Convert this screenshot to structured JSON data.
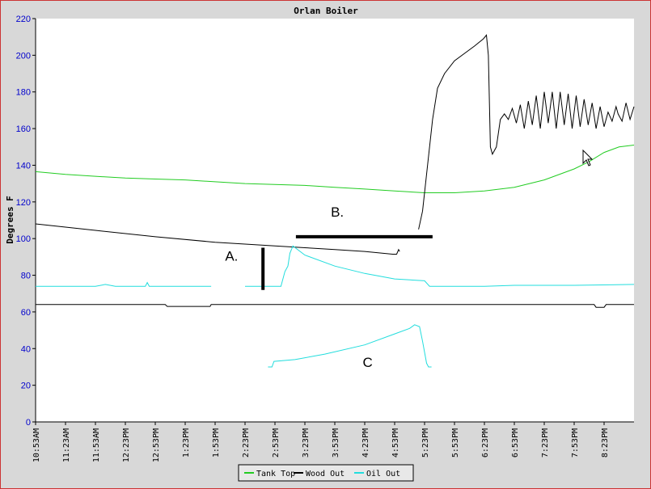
{
  "chart_data": {
    "type": "line",
    "title": "Orlan Boiler",
    "ylabel": "Degrees F",
    "xlabel": "",
    "ylim": [
      0,
      220
    ],
    "y_ticks": [
      0,
      20,
      40,
      60,
      80,
      100,
      120,
      140,
      160,
      180,
      200,
      220
    ],
    "x_ticks": [
      "10:53AM",
      "11:23AM",
      "11:53AM",
      "12:23PM",
      "12:53PM",
      "1:23PM",
      "1:53PM",
      "2:23PM",
      "2:53PM",
      "3:23PM",
      "3:53PM",
      "4:23PM",
      "4:53PM",
      "5:23PM",
      "5:53PM",
      "6:23PM",
      "6:53PM",
      "7:23PM",
      "7:53PM",
      "8:23PM"
    ],
    "x_ticks_minutes": [
      0,
      30,
      60,
      90,
      120,
      150,
      180,
      210,
      240,
      270,
      300,
      330,
      360,
      390,
      420,
      450,
      480,
      510,
      540,
      570
    ],
    "xlim_minutes": [
      0,
      600
    ],
    "grid": false,
    "legend_position": "bottom-center",
    "colors": {
      "tank_top": "#22cc22",
      "wood_out": "#000000",
      "oil_out": "#22dddd",
      "axis_text": "#0000cc",
      "tick_text": "#000000"
    },
    "series": [
      {
        "name": "Tank Top",
        "color": "#22cc22",
        "points": [
          [
            0,
            136.5
          ],
          [
            30,
            135
          ],
          [
            60,
            134
          ],
          [
            90,
            133
          ],
          [
            120,
            132.5
          ],
          [
            150,
            132
          ],
          [
            180,
            131
          ],
          [
            210,
            130
          ],
          [
            240,
            129.5
          ],
          [
            270,
            129
          ],
          [
            300,
            128
          ],
          [
            330,
            127
          ],
          [
            360,
            126
          ],
          [
            390,
            125
          ],
          [
            420,
            125
          ],
          [
            450,
            126
          ],
          [
            480,
            128
          ],
          [
            510,
            132
          ],
          [
            540,
            138
          ],
          [
            555,
            142
          ],
          [
            570,
            147
          ],
          [
            585,
            150
          ],
          [
            600,
            151
          ]
        ]
      },
      {
        "name": "Wood Out",
        "color": "#000000",
        "segments": [
          [
            [
              0,
              108
            ],
            [
              60,
              104.5
            ],
            [
              120,
              101
            ],
            [
              180,
              98
            ],
            [
              240,
              96
            ],
            [
              270,
              95
            ],
            [
              300,
              94
            ],
            [
              330,
              93
            ],
            [
              358,
              91.5
            ],
            [
              362,
              91.5
            ],
            [
              364,
              94
            ],
            [
              365,
              93
            ]
          ],
          [
            [
              384,
              105
            ],
            [
              388,
              115
            ],
            [
              393,
              140
            ],
            [
              398,
              165
            ],
            [
              403,
              182
            ],
            [
              410,
              190
            ],
            [
              420,
              197
            ],
            [
              440,
              205
            ],
            [
              449,
              209
            ],
            [
              452,
              211
            ],
            [
              454,
              200
            ],
            [
              456,
              150
            ],
            [
              458,
              146
            ],
            [
              462,
              150
            ],
            [
              466,
              165
            ],
            [
              470,
              168
            ],
            [
              474,
              165
            ],
            [
              478,
              171
            ],
            [
              482,
              163
            ],
            [
              486,
              173
            ],
            [
              490,
              160
            ],
            [
              494,
              175
            ],
            [
              498,
              162
            ],
            [
              502,
              178
            ],
            [
              506,
              160
            ],
            [
              510,
              180
            ],
            [
              514,
              163
            ],
            [
              518,
              180
            ],
            [
              522,
              160
            ],
            [
              526,
              180
            ],
            [
              530,
              162
            ],
            [
              534,
              179
            ],
            [
              538,
              160
            ],
            [
              542,
              178
            ],
            [
              546,
              161
            ],
            [
              550,
              176
            ],
            [
              554,
              162
            ],
            [
              558,
              174
            ],
            [
              562,
              160
            ],
            [
              566,
              172
            ],
            [
              570,
              161
            ],
            [
              574,
              169
            ],
            [
              578,
              164
            ],
            [
              582,
              172
            ],
            [
              584,
              168
            ],
            [
              588,
              164
            ],
            [
              592,
              174
            ],
            [
              596,
              165
            ],
            [
              600,
              172
            ]
          ],
          [
            [
              0,
              64
            ],
            [
              130,
              64
            ],
            [
              132,
              63
            ],
            [
              175,
              63
            ],
            [
              176,
              64
            ],
            [
              190,
              64
            ],
            [
              215,
              64
            ],
            [
              560,
              64
            ],
            [
              562,
              62.5
            ],
            [
              570,
              62.5
            ],
            [
              572,
              64
            ],
            [
              600,
              64
            ]
          ]
        ]
      },
      {
        "name": "Oil Out",
        "color": "#22dddd",
        "segments": [
          [
            [
              0,
              74
            ],
            [
              60,
              74
            ],
            [
              70,
              75
            ],
            [
              80,
              74
            ],
            [
              110,
              74
            ],
            [
              112,
              76
            ],
            [
              114,
              74
            ],
            [
              176,
              74
            ]
          ],
          [
            [
              210,
              74
            ],
            [
              246,
              74
            ],
            [
              250,
              82
            ],
            [
              253,
              85
            ],
            [
              255,
              92
            ],
            [
              258,
              96
            ],
            [
              270,
              91
            ],
            [
              300,
              85
            ],
            [
              330,
              81
            ],
            [
              360,
              78
            ],
            [
              390,
              77
            ],
            [
              395,
              74
            ],
            [
              420,
              74
            ],
            [
              450,
              74
            ],
            [
              480,
              74.5
            ],
            [
              540,
              74.5
            ],
            [
              600,
              75
            ]
          ],
          [
            [
              233,
              30
            ],
            [
              237,
              30
            ],
            [
              239,
              33
            ],
            [
              260,
              34
            ],
            [
              290,
              37
            ],
            [
              330,
              42
            ],
            [
              360,
              48
            ],
            [
              375,
              51
            ],
            [
              380,
              53
            ],
            [
              385,
              52
            ],
            [
              388,
              44
            ],
            [
              392,
              32
            ],
            [
              394,
              30
            ],
            [
              397,
              30
            ]
          ]
        ]
      }
    ],
    "annotations": [
      {
        "label": "A.",
        "x": 190,
        "y": 88
      },
      {
        "label": "B.",
        "x": 296,
        "y": 112
      },
      {
        "label": "C",
        "x": 328,
        "y": 30
      }
    ],
    "annotation_bars": [
      {
        "type": "vertical",
        "x": 228,
        "y1": 72,
        "y2": 95
      },
      {
        "type": "horizontal",
        "y": 101,
        "x1": 261,
        "x2": 398
      }
    ]
  },
  "legend": {
    "items": [
      {
        "label": "Tank Top",
        "color": "#22cc22"
      },
      {
        "label": "Wood Out",
        "color": "#000000"
      },
      {
        "label": "Oil Out",
        "color": "#22dddd"
      }
    ]
  },
  "cursor": {
    "icon": "mouse-pointer-icon"
  }
}
